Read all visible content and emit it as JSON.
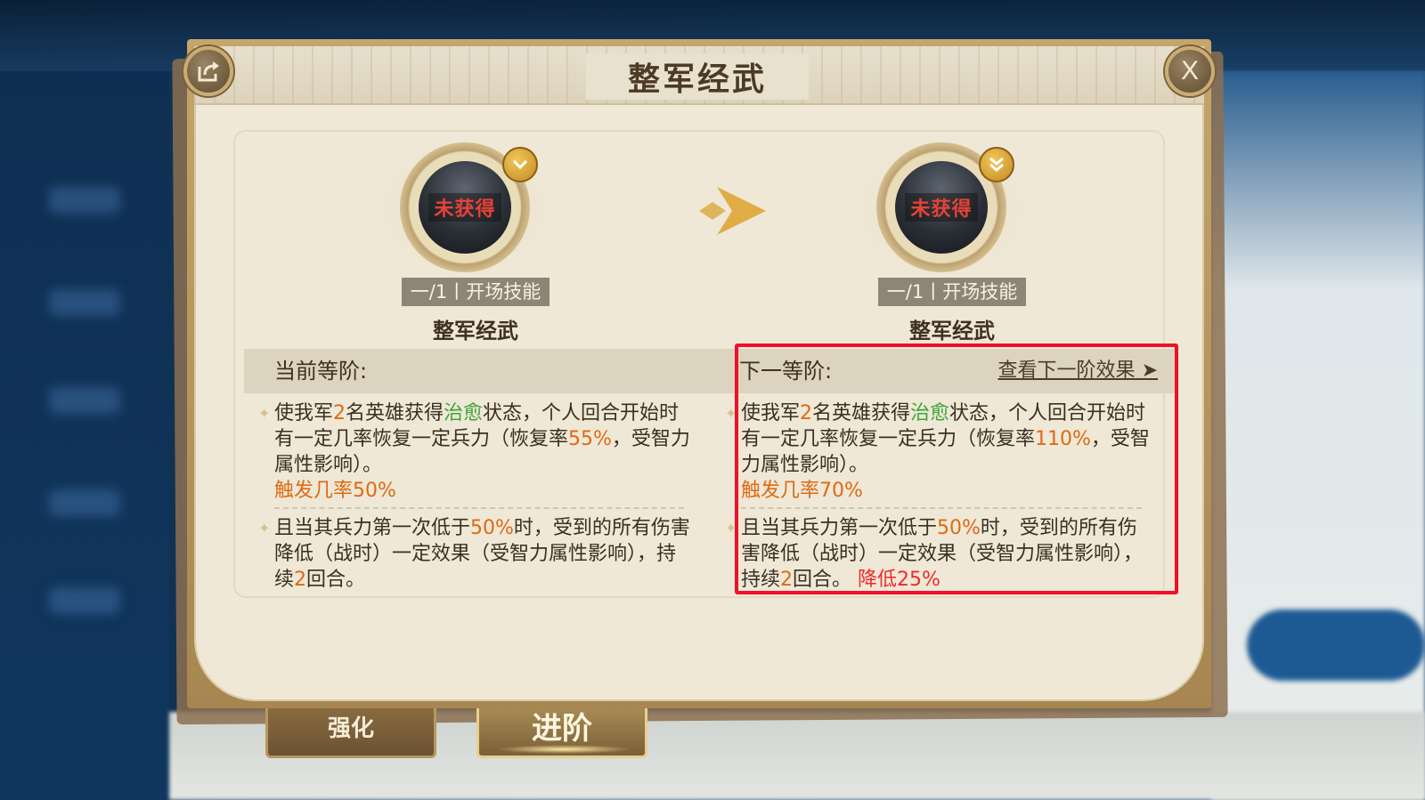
{
  "dialog": {
    "title": "整军经武",
    "share_icon": "share-icon",
    "close_glyph": "X"
  },
  "current_skill": {
    "status": "未获得",
    "tag": "一/1丨开场技能",
    "name": "整军经武",
    "rank_icon": "chevron-down-icon"
  },
  "next_skill": {
    "status": "未获得",
    "tag": "一/1丨开场技能",
    "name": "整军经武",
    "rank_icon": "double-chevron-down-icon"
  },
  "current_tier": {
    "heading": "当前等阶:",
    "effect1": {
      "t1": "使我军",
      "n1": "2",
      "t2": "名英雄获得",
      "status": "治愈",
      "t3": "状态，个人回合开始时有一定几率恢复一定兵力（恢复率",
      "rate": "55%",
      "t4": "，受智力属性影响）。",
      "trigger": "触发几率50%"
    },
    "effect2": {
      "t1": "且当其兵力第一次低于",
      "threshold": "50%",
      "t2": "时，受到的所有伤害降低（战时）一定效果（受智力属性影响），持续",
      "rounds": "2",
      "t3": "回合。"
    }
  },
  "next_tier": {
    "heading": "下一等阶:",
    "link": "查看下一阶效果",
    "link_arrow": "➤",
    "effect1": {
      "t1": "使我军",
      "n1": "2",
      "t2": "名英雄获得",
      "status": "治愈",
      "t3": "状态，个人回合开始时有一定几率恢复一定兵力（恢复率",
      "rate": "110%",
      "t4": "，受智力属性影响）。",
      "trigger": "触发几率70%"
    },
    "effect2": {
      "t1": "且当其兵力第一次低于",
      "threshold": "50%",
      "t2": "时，受到的所有伤害降低（战时）一定效果（受智力属性影响），持续",
      "rounds": "2",
      "t3": "回合。",
      "reduction": "降低25%"
    }
  },
  "tabs": {
    "strengthen": "强化",
    "advance": "进阶"
  },
  "colors": {
    "highlight": "#de6a14",
    "heal": "#3ea53a",
    "annotation": "#f0102a"
  }
}
